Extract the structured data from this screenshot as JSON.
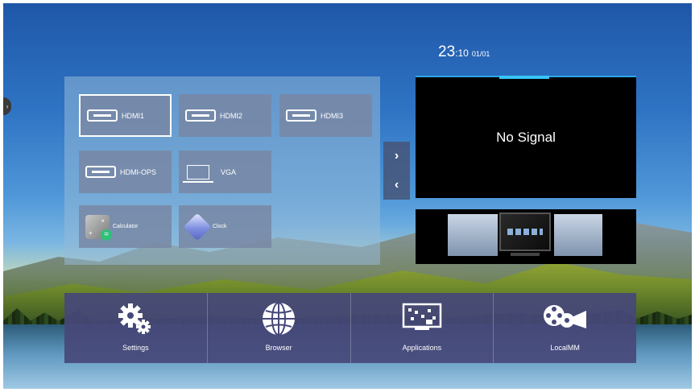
{
  "status": {
    "time": "23",
    "time_minutes": ":10",
    "date": "01/01"
  },
  "sources": [
    {
      "label": "HDMI1",
      "icon": "hdmi-port-icon",
      "selected": true
    },
    {
      "label": "HDMI2",
      "icon": "hdmi-port-icon"
    },
    {
      "label": "HDMI3",
      "icon": "hdmi-port-icon"
    },
    {
      "label": "HDMI-OPS",
      "icon": "hdmi-port-icon"
    },
    {
      "label": "VGA",
      "icon": "vga-monitor-icon"
    }
  ],
  "apps": [
    {
      "label": "Calculator",
      "icon": "calculator-icon"
    },
    {
      "label": "Clock",
      "icon": "clock-icon"
    }
  ],
  "nav": {
    "next_glyph": "›",
    "prev_glyph": "‹"
  },
  "preview": {
    "message": "No Signal"
  },
  "dock": [
    {
      "label": "Settings",
      "icon": "gears-icon"
    },
    {
      "label": "Browser",
      "icon": "globe-icon"
    },
    {
      "label": "Applications",
      "icon": "applications-icon"
    },
    {
      "label": "LocalMM",
      "icon": "film-reel-icon"
    }
  ],
  "colors": {
    "accent": "#39c4ff",
    "tile": "#7887a5",
    "dock": "#46487a"
  }
}
